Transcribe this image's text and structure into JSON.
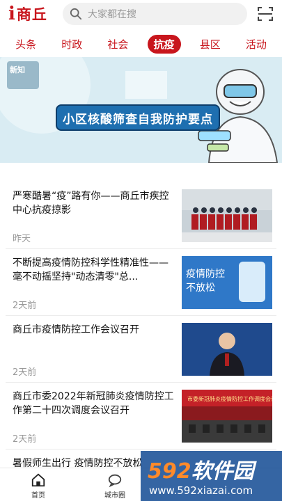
{
  "header": {
    "logo_i": "i",
    "logo_text": "商丘",
    "search_placeholder": "大家都在搜"
  },
  "tabs": [
    {
      "label": "头条"
    },
    {
      "label": "时政"
    },
    {
      "label": "社会"
    },
    {
      "label": "抗疫",
      "active": true
    },
    {
      "label": "县区"
    },
    {
      "label": "活动"
    }
  ],
  "banner": {
    "badge": "新知",
    "caption": "小区核酸筛查自我防护要点"
  },
  "news": [
    {
      "title": "严寒酷暑“疫”路有你——商丘市疾控中心抗疫掠影",
      "time": "昨天"
    },
    {
      "title": "不断提高疫情防控科学性精准性——毫不动摇坚持\"动态清零\"总...",
      "time": "2天前",
      "thumb_text": "疫情防控\n不放松"
    },
    {
      "title": "商丘市疫情防控工作会议召开",
      "time": "2天前"
    },
    {
      "title": "商丘市委2022年新冠肺炎疫情防控工作第二十四次调度会议召开",
      "time": "2天前",
      "thumb_text": "市委新冠肺炎疫情防控工作调度会议"
    },
    {
      "title": "暑假师生出行 疫情防控不放松"
    }
  ],
  "bottom_nav": [
    {
      "label": "首页",
      "icon": "home-icon"
    },
    {
      "label": "城市圈",
      "icon": "chat-icon"
    }
  ],
  "watermark": {
    "brand_num": "592",
    "brand_txt": "软件园",
    "url": "www.592xiazai.com"
  },
  "colors": {
    "accent": "#c8161d",
    "watermark": "#1950a0"
  }
}
